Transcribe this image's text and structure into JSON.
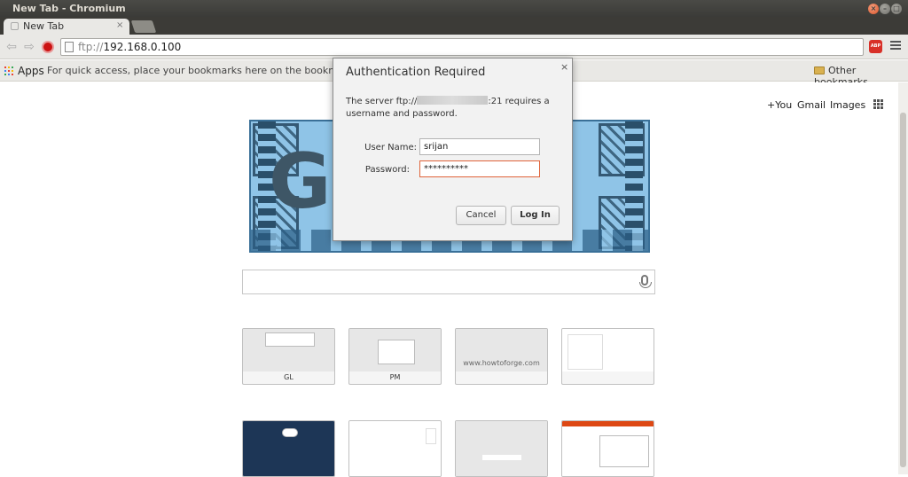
{
  "window": {
    "title": "New Tab - Chromium",
    "buttons": [
      "×",
      "–",
      "□"
    ]
  },
  "tabs": [
    {
      "label": "New Tab",
      "close": "×"
    }
  ],
  "toolbar": {
    "url_scheme": "ftp://",
    "url_host": "192.168.0.100",
    "abp_label": "ABP"
  },
  "bookmarks": {
    "apps_label": "Apps",
    "hint": "For quick access, place your bookmarks here on the bookmarks bar. Im",
    "other_label": "Other bookmarks"
  },
  "google": {
    "links": [
      "+You",
      "Gmail",
      "Images"
    ],
    "doodle_letters": "G   E"
  },
  "tiles": [
    {
      "caption": "GL"
    },
    {
      "caption": "PM"
    },
    {
      "caption": "",
      "site_text": "www.howtoforge.com"
    },
    {
      "caption": ""
    },
    {
      "caption": ""
    },
    {
      "caption": ""
    },
    {
      "caption": ""
    },
    {
      "caption": ""
    }
  ],
  "dialog": {
    "title": "Authentication Required",
    "close": "×",
    "msg_prefix": "The server ftp://",
    "msg_suffix": ":21 requires a username and password.",
    "username_label": "User Name:",
    "username_value": "srijan",
    "password_label": "Password:",
    "password_value": "**********",
    "cancel_label": "Cancel",
    "login_label": "Log In"
  },
  "colors": {
    "accent_focus": "#e0643a",
    "stop_red": "#cc1212",
    "abp_red": "#d83028"
  }
}
